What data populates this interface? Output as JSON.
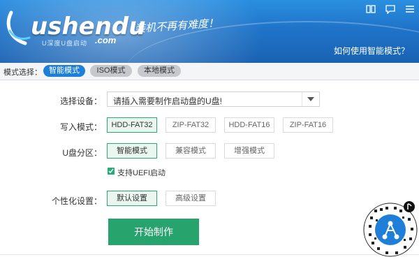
{
  "header": {
    "logo_main": "ushendu",
    "logo_sub": "U深度U盘启动",
    "logo_com": ".com",
    "slogan": "装机不再有难度！",
    "help_link": "如何使用智能模式？",
    "window_icons": [
      "manual-icon",
      "feedback-icon",
      "menu-icon"
    ]
  },
  "modebar": {
    "label": "模式选择：",
    "modes": [
      {
        "label": "智能模式",
        "active": true
      },
      {
        "label": "ISO模式",
        "active": false
      },
      {
        "label": "本地模式",
        "active": false
      }
    ]
  },
  "device": {
    "label": "选择设备：",
    "value": "请插入需要制作启动盘的U盘!"
  },
  "write_mode": {
    "label": "写入模式：",
    "options": [
      "HDD-FAT32",
      "ZIP-FAT32",
      "HDD-FAT16",
      "ZIP-FAT16"
    ],
    "selected": "HDD-FAT32"
  },
  "partition": {
    "label": "U盘分区：",
    "options": [
      "智能模式",
      "兼容模式",
      "增强模式"
    ],
    "selected": "智能模式",
    "uefi_label": "支持UEFI启动",
    "uefi_checked": true
  },
  "personalize": {
    "label": "个性化设置：",
    "options": [
      "默认设置",
      "高级设置"
    ],
    "selected": "默认设置"
  },
  "start_button": "开始制作",
  "colors": {
    "header_blue": "#1f74c9",
    "accent_blue": "#1d7fd8",
    "accent_green": "#27a36e"
  }
}
